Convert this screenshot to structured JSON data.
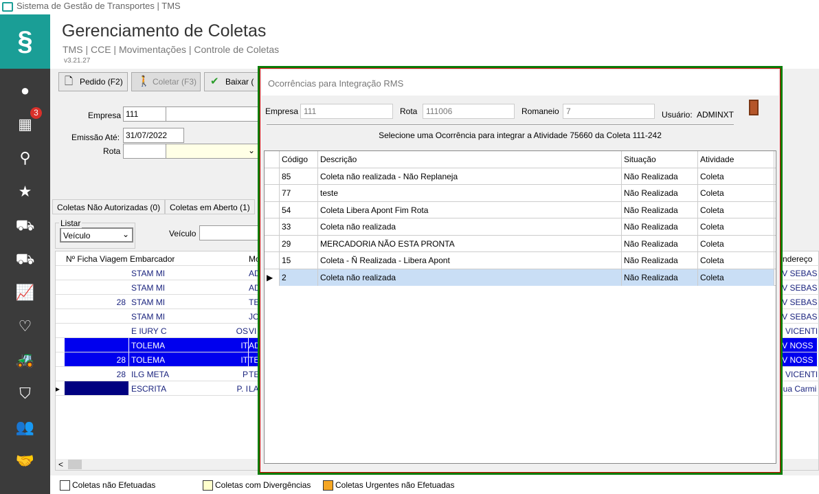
{
  "window": {
    "title": "Sistema de Gestão de Transportes | TMS"
  },
  "sidebar": {
    "badge": "3",
    "icons": [
      "user-icon",
      "grid-icon",
      "search-icon",
      "star-icon",
      "truck-icon",
      "truck-icon",
      "chart-icon",
      "heart-icon",
      "tractor-icon",
      "shield-icon",
      "team-icon",
      "handshake-icon"
    ],
    "accent": "#1a9e96"
  },
  "header": {
    "title": "Gerenciamento de Coletas",
    "breadcrumb": "TMS | CCE | Movimentações | Controle de Coletas",
    "version": "v3.21.27"
  },
  "toolbar": {
    "pedido": "Pedido (F2)",
    "coletar": "Coletar (F3)",
    "baixar": "Baixar ("
  },
  "form": {
    "empresa_label": "Empresa",
    "empresa_value": "111",
    "emissao_label": "Emissão Até:",
    "emissao_value": "31/07/2022",
    "rota_label": "Rota",
    "listar_label": "Listar",
    "listar_value": "Veículo",
    "veiculo_label": "Veículo"
  },
  "tabs": [
    "Coletas Não Autorizadas (0)",
    "Coletas em Aberto (1)"
  ],
  "bg_grid": {
    "headers": [
      "Nº Ficha Viagem",
      "Embarcador",
      "Mo",
      "ndereço"
    ],
    "rows": [
      {
        "ficha": "",
        "emb": "STAM MI",
        "mid": "",
        "mo": "AD",
        "end": "AV SEBAS",
        "hl": false
      },
      {
        "ficha": "",
        "emb": "STAM MI",
        "mid": "",
        "mo": "AD",
        "end": "AV SEBAS",
        "hl": false
      },
      {
        "ficha": "28",
        "emb": "STAM MI",
        "mid": "",
        "mo": "TE",
        "end": "AV SEBAS",
        "hl": false
      },
      {
        "ficha": "",
        "emb": "STAM MI",
        "mid": "",
        "mo": "JO",
        "end": "AV SEBAS",
        "hl": false
      },
      {
        "ficha": "",
        "emb": "E IURY C",
        "mid": "OS",
        "mo": "VI",
        "end": "R VICENTE",
        "hl": false
      },
      {
        "ficha": "",
        "emb": "TOLEMA",
        "mid": "IT",
        "mo": "AD",
        "end": "AV NOSS",
        "hl": true
      },
      {
        "ficha": "28",
        "emb": "TOLEMA",
        "mid": "IT",
        "mo": "TE",
        "end": "AV NOSS",
        "hl": true
      },
      {
        "ficha": "28",
        "emb": "ILG META",
        "mid": "P",
        "mo": "TE",
        "end": "R VICENTE",
        "hl": false
      },
      {
        "ficha": "",
        "emb": "ESCRITA",
        "mid": "P. I",
        "mo": "LA",
        "end": "Rua Carmi",
        "hl": false
      }
    ]
  },
  "legend": [
    "Coletas não Efetuadas",
    "Coletas com Divergências",
    "Coletas Urgentes não Efetuadas"
  ],
  "legend_colors": [
    "#ffffff",
    "#ffffcc",
    "#f5a623"
  ],
  "modal": {
    "title": "Ocorrências para Integração RMS",
    "empresa_label": "Empresa",
    "empresa": "111",
    "rota_label": "Rota",
    "rota": "111006",
    "romaneio_label": "Romaneio",
    "romaneio": "7",
    "usuario_label": "Usuário:",
    "usuario": "ADMINXT",
    "message": "Selecione uma Ocorrência para integrar a Atividade 75660 da Coleta 111-242",
    "columns": [
      "Código",
      "Descrição",
      "Situação",
      "Atividade"
    ],
    "rows": [
      {
        "codigo": "85",
        "descricao": "Coleta não realizada - Não Replaneja",
        "situacao": "Não Realizada",
        "atividade": "Coleta"
      },
      {
        "codigo": "77",
        "descricao": "teste",
        "situacao": "Não Realizada",
        "atividade": "Coleta"
      },
      {
        "codigo": "54",
        "descricao": "Coleta Libera Apont Fim Rota",
        "situacao": "Não Realizada",
        "atividade": "Coleta"
      },
      {
        "codigo": "33",
        "descricao": "Coleta não realizada",
        "situacao": "Não Realizada",
        "atividade": "Coleta"
      },
      {
        "codigo": "29",
        "descricao": "MERCADORIA NÃO ESTA PRONTA",
        "situacao": "Não Realizada",
        "atividade": "Coleta"
      },
      {
        "codigo": "15",
        "descricao": "Coleta - Ñ Realizada - Libera Apont",
        "situacao": "Não Realizada",
        "atividade": "Coleta"
      },
      {
        "codigo": "2",
        "descricao": "Coleta não realizada",
        "situacao": "Não Realizada",
        "atividade": "Coleta",
        "selected": true
      }
    ]
  }
}
